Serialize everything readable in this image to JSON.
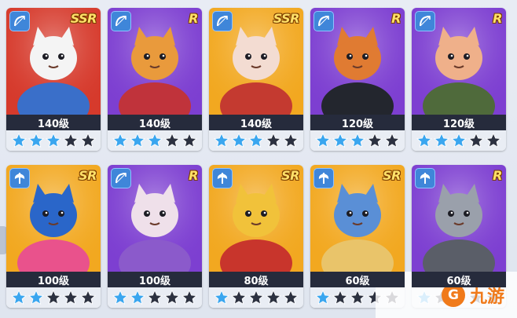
{
  "colors": {
    "ssr_bg": "#d63a2c",
    "sr_bg": "#f2a820",
    "r_bg": "#7d3fd1",
    "level_bar": "#262b3c",
    "star_filled": "#3aa6ef",
    "star_empty": "#2c3140",
    "badge": "#3f86d9"
  },
  "heroes": [
    {
      "rarity": "SSR",
      "level": "140级",
      "stars": 3,
      "weapon_icon": "bow-icon",
      "art": "eagle",
      "bg": "#d63a2c"
    },
    {
      "rarity": "R",
      "level": "140级",
      "stars": 3,
      "weapon_icon": "bow-icon",
      "art": "fatcat",
      "bg": "#7d3fd1"
    },
    {
      "rarity": "SSR",
      "level": "140级",
      "stars": 3,
      "weapon_icon": "bow-icon",
      "art": "archer",
      "bg": "#f2a820"
    },
    {
      "rarity": "R",
      "level": "120级",
      "stars": 3,
      "weapon_icon": "bow-icon",
      "art": "pirate",
      "bg": "#7d3fd1"
    },
    {
      "rarity": "R",
      "level": "120级",
      "stars": 3,
      "weapon_icon": "bow-icon",
      "art": "pilot",
      "bg": "#7d3fd1"
    },
    {
      "rarity": "SR",
      "level": "100级",
      "stars": 2,
      "weapon_icon": "axe-icon",
      "art": "cap",
      "bg": "#f2a820"
    },
    {
      "rarity": "R",
      "level": "100级",
      "stars": 2,
      "weapon_icon": "bow-icon",
      "art": "mage",
      "bg": "#7d3fd1"
    },
    {
      "rarity": "SR",
      "level": "80级",
      "stars": 1,
      "weapon_icon": "axe-icon",
      "art": "spartan",
      "bg": "#f2a820"
    },
    {
      "rarity": "SR",
      "level": "60级",
      "stars": 1,
      "weapon_icon": "axe-icon",
      "art": "bluecat",
      "bg": "#f2a820"
    },
    {
      "rarity": "R",
      "level": "60级",
      "stars": 1,
      "weapon_icon": "axe-icon",
      "art": "knight",
      "bg": "#7d3fd1"
    }
  ],
  "watermark": {
    "logo": "G",
    "text": "九游"
  }
}
